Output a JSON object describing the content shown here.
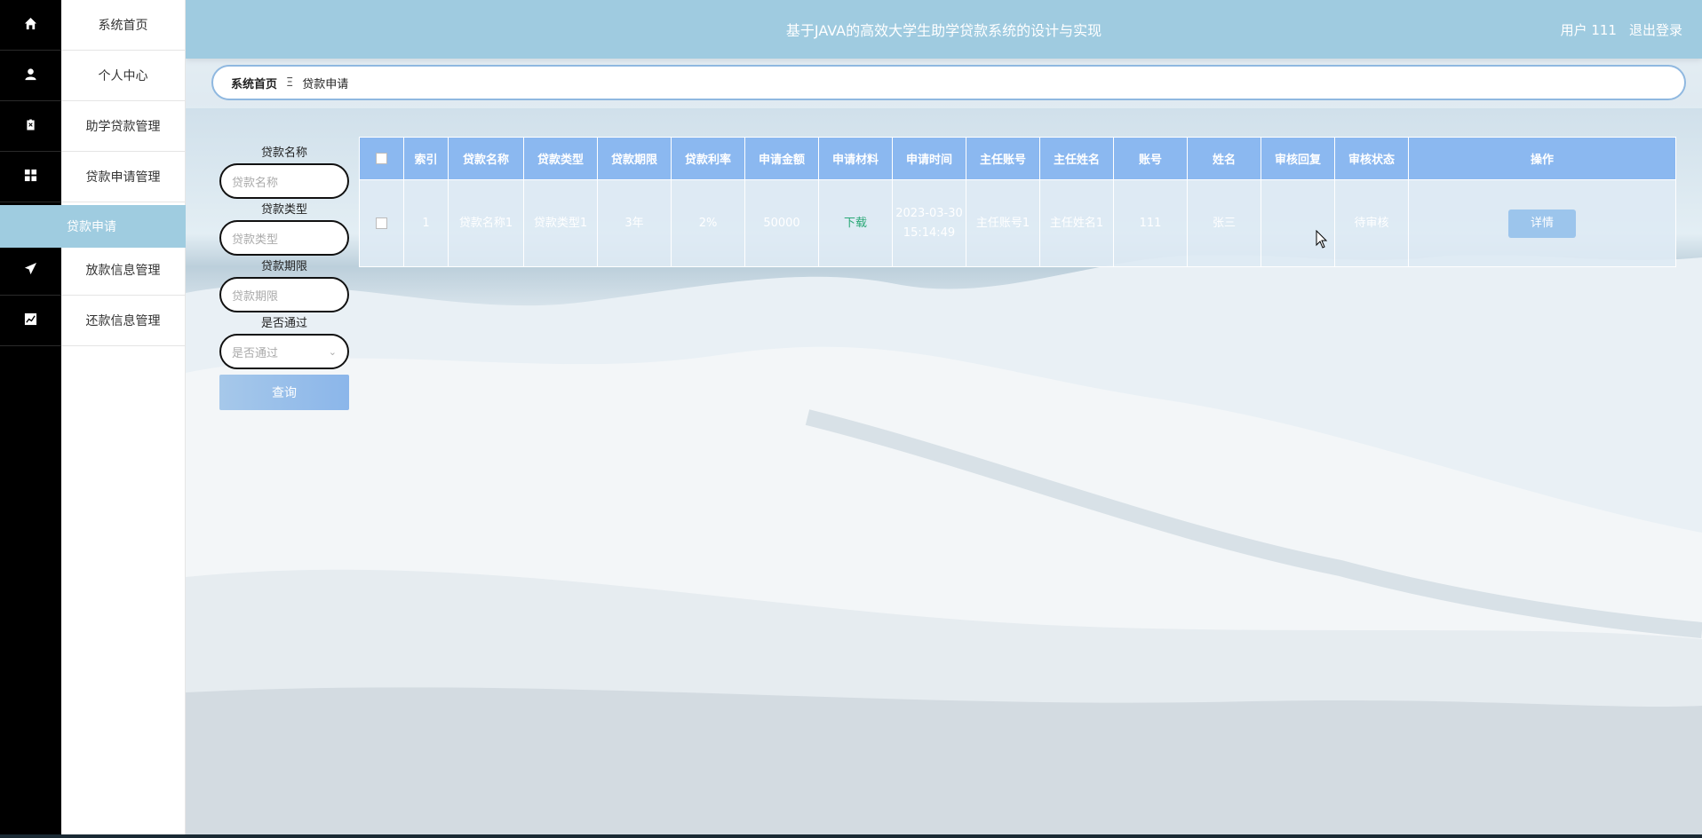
{
  "app": {
    "title": "基于JAVA的高效大学生助学贷款系统的设计与实现",
    "user_label": "用户 111",
    "logout_label": "退出登录"
  },
  "sidebar": {
    "items": [
      {
        "label": "系统首页",
        "icon": "home-icon"
      },
      {
        "label": "个人中心",
        "icon": "user-icon"
      },
      {
        "label": "助学贷款管理",
        "icon": "clipboard-icon"
      },
      {
        "label": "贷款申请管理",
        "icon": "grid-icon"
      },
      {
        "label": "放款信息管理",
        "icon": "send-icon"
      },
      {
        "label": "还款信息管理",
        "icon": "chart-icon"
      }
    ],
    "active_sub": "贷款申请"
  },
  "breadcrumb": {
    "home": "系统首页",
    "separator": "Ξ",
    "current": "贷款申请"
  },
  "search": {
    "loan_name_label": "贷款名称",
    "loan_name_placeholder": "贷款名称",
    "loan_type_label": "贷款类型",
    "loan_type_placeholder": "贷款类型",
    "loan_term_label": "贷款期限",
    "loan_term_placeholder": "贷款期限",
    "passed_label": "是否通过",
    "passed_placeholder": "是否通过",
    "query_button": "查询"
  },
  "table": {
    "headers": [
      "索引",
      "贷款名称",
      "贷款类型",
      "贷款期限",
      "贷款利率",
      "申请金额",
      "申请材料",
      "申请时间",
      "主任账号",
      "主任姓名",
      "账号",
      "姓名",
      "审核回复",
      "审核状态",
      "操作"
    ],
    "rows": [
      {
        "index": "1",
        "loan_name": "贷款名称1",
        "loan_type": "贷款类型1",
        "loan_term": "3年",
        "loan_rate": "2%",
        "amount": "50000",
        "material": "下载",
        "apply_time": "2023-03-30 15:14:49",
        "director_account": "主任账号1",
        "director_name": "主任姓名1",
        "account": "111",
        "name": "张三",
        "reply": "",
        "status": "待审核",
        "action": "详情"
      }
    ]
  },
  "colors": {
    "topbar": "#9fcbe0",
    "table_header": "#8bb8f0",
    "active_sidebar": "#9fcce0",
    "download_link": "#2aa876"
  }
}
